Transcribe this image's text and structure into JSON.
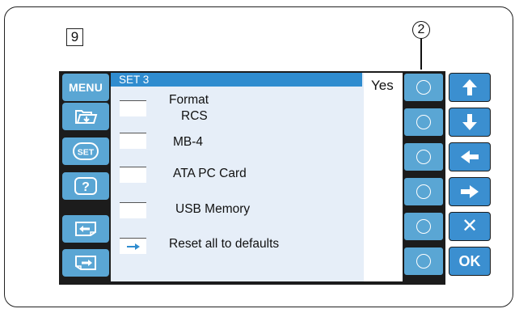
{
  "step_number": "9",
  "callout_number": "2",
  "title": "SET 3",
  "yes_label": "Yes",
  "left_buttons": [
    {
      "label": "MENU",
      "icon": "menu-text"
    },
    {
      "icon": "folder-open-icon"
    },
    {
      "label": "SET",
      "icon": "set-icon"
    },
    {
      "label": "?",
      "icon": "help-icon"
    },
    {
      "icon": "page-back-icon"
    },
    {
      "icon": "page-forward-icon"
    }
  ],
  "options": [
    {
      "label_line1": "Format",
      "label_line2": "RCS",
      "selected": false
    },
    {
      "label": "MB-4",
      "selected": false
    },
    {
      "label": "ATA PC Card",
      "selected": false
    },
    {
      "label": "USB Memory",
      "selected": false
    },
    {
      "label": "Reset all to defaults",
      "selected": true,
      "marker_icon": "arrow-right-icon"
    }
  ],
  "right_nav": [
    {
      "icon": "arrow-up-icon"
    },
    {
      "icon": "arrow-down-icon"
    },
    {
      "icon": "arrow-left-icon"
    },
    {
      "icon": "arrow-right-icon"
    },
    {
      "label": "✕",
      "icon": "close-icon"
    },
    {
      "label": "OK",
      "icon": "ok-icon"
    }
  ],
  "colors": {
    "button_blue": "#5aa6d4",
    "nav_blue": "#3b8fd0",
    "title_bar": "#2f8ccf",
    "panel_bg": "#e6eef8"
  }
}
